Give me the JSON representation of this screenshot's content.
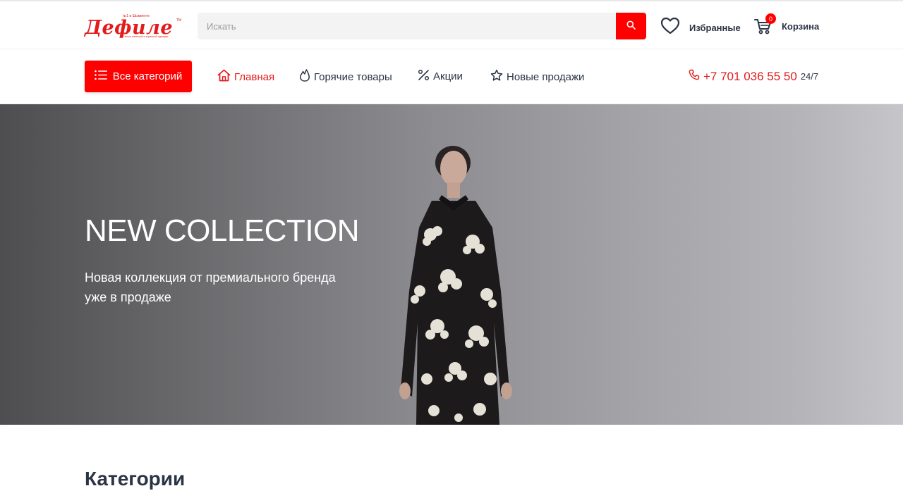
{
  "header": {
    "logo": {
      "word": "Дефиле",
      "tagline": "№1 в Шымкенте",
      "subtitle": "Салон женской и мужской одежды",
      "tm": "TM"
    },
    "search": {
      "placeholder": "Искать"
    },
    "favorites_label": "Избранные",
    "cart_label": "Корзина",
    "cart_count": "0"
  },
  "nav": {
    "categories_button": "Все категорий",
    "items": [
      {
        "label": "Главная",
        "icon": "home-icon",
        "active": true
      },
      {
        "label": "Горячие товары",
        "icon": "flame-icon",
        "active": false
      },
      {
        "label": "Акции",
        "icon": "percent-icon",
        "active": false
      },
      {
        "label": "Новые продажи",
        "icon": "star-icon",
        "active": false
      }
    ],
    "phone": "+7 701 036 55 50",
    "phone_hours": "24/7"
  },
  "hero": {
    "title": "NEW COLLECTION",
    "subtitle": "Новая коллекция от премиального бренда уже в продаже"
  },
  "sections": {
    "categories_title": "Категории"
  },
  "colors": {
    "accent": "#ff0000",
    "text": "#2b3445",
    "brand_red": "#e31b1b"
  }
}
